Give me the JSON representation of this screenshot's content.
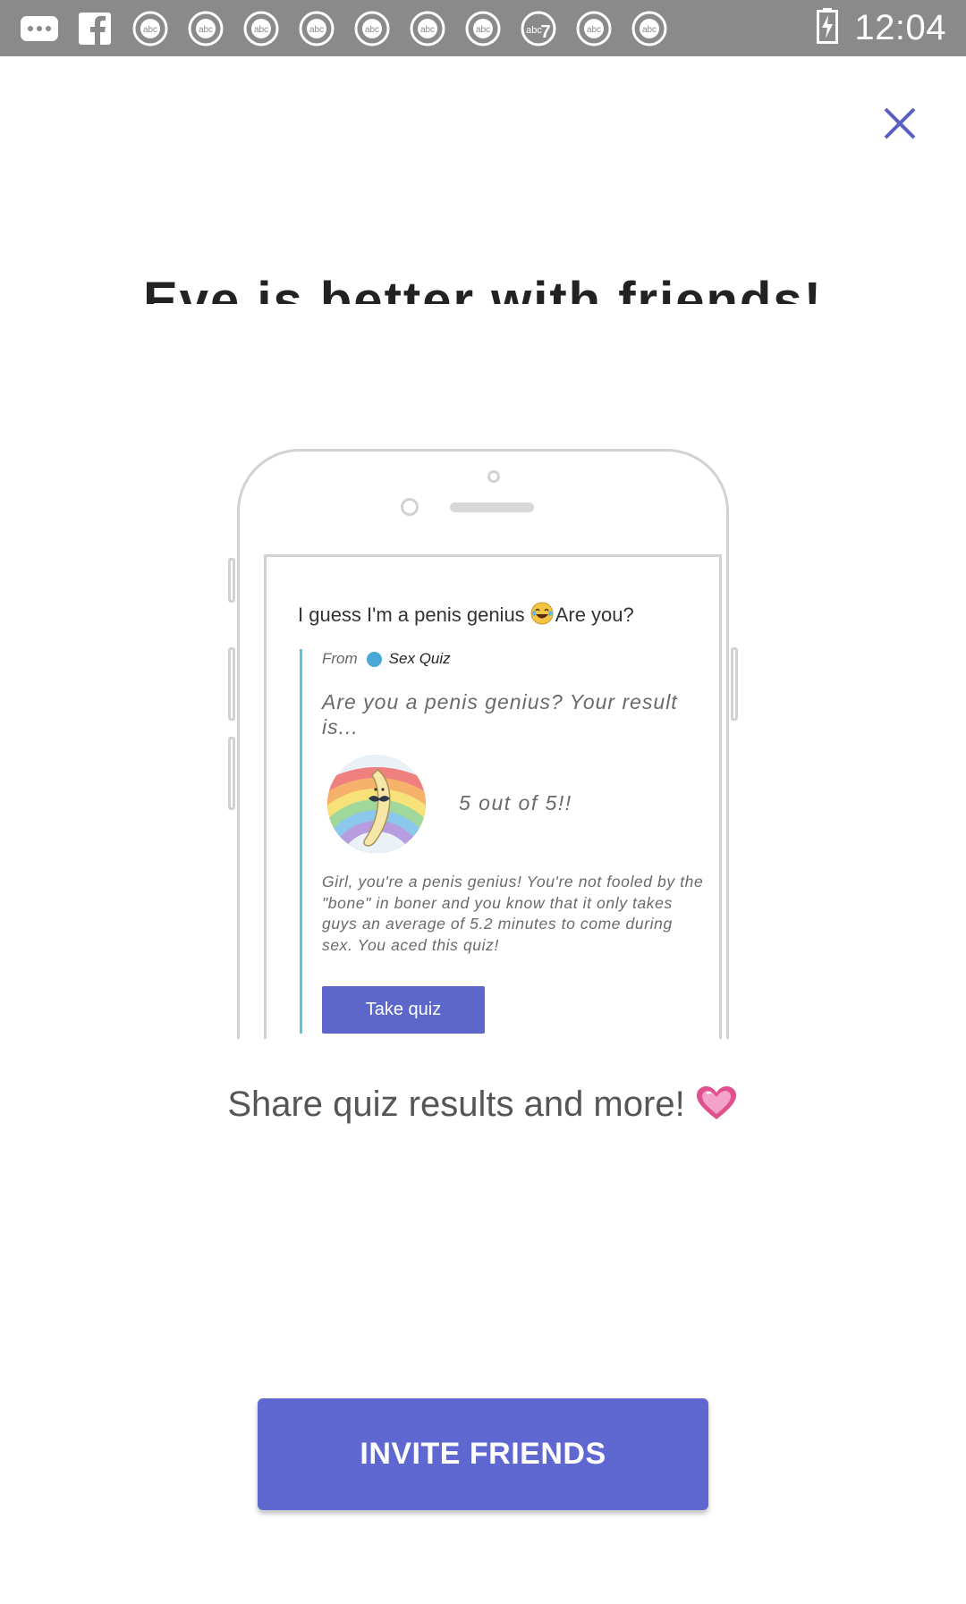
{
  "status_bar": {
    "time": "12:04",
    "left_icons": [
      "more-icon",
      "facebook-icon",
      "abc-news-icon",
      "abc-news-icon",
      "abc-news-icon",
      "abc-news-icon",
      "abc-news-icon",
      "abc-news-icon",
      "abc-news-icon",
      "abc7-icon",
      "abc-news-icon",
      "abc-news-icon"
    ],
    "right_icons": [
      "battery-icon"
    ]
  },
  "header": {
    "close_icon": "close-icon",
    "title": "Eve is better with friends!"
  },
  "illustration": {
    "message": "I guess I'm a penis genius",
    "message_tail": "Are you?",
    "from_label": "From",
    "from_source": "Sex Quiz",
    "question": "Are you a penis genius? Your result is...",
    "score": "5 out of 5!!",
    "description": "Girl, you're a penis genius! You're not fooled by the \"bone\" in boner and you know that it only takes guys an average of 5.2 minutes to come during sex. You aced this quiz!",
    "button_label": "Take quiz"
  },
  "subtitle": "Share quiz results and more!",
  "invite_button": "INVITE FRIENDS",
  "colors": {
    "accent": "#5f67d0",
    "status_bar": "#8a8a8a",
    "close": "#5a5fc4"
  }
}
